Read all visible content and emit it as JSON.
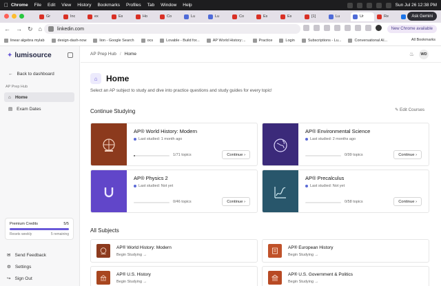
{
  "os_menubar": {
    "app": "Chrome",
    "items": [
      "File",
      "Edit",
      "View",
      "History",
      "Bookmarks",
      "Profiles",
      "Tab",
      "Window",
      "Help"
    ],
    "clock": "Sun Jul 26  12:38 PM"
  },
  "tabs": [
    {
      "label": "Gr",
      "color": "#d93025"
    },
    {
      "label": "Inc",
      "color": "#d93025"
    },
    {
      "label": "ex",
      "color": "#d93025"
    },
    {
      "label": "Es",
      "color": "#d93025"
    },
    {
      "label": "Ho",
      "color": "#d93025"
    },
    {
      "label": "Co",
      "color": "#d93025"
    },
    {
      "label": "Lu",
      "color": "#4f6bd8"
    },
    {
      "label": "Lu",
      "color": "#4f6bd8"
    },
    {
      "label": "Co",
      "color": "#d93025"
    },
    {
      "label": "Es",
      "color": "#d93025"
    },
    {
      "label": "Es",
      "color": "#d93025"
    },
    {
      "label": "[1]",
      "color": "#d93025"
    },
    {
      "label": "Lu",
      "color": "#4f6bd8"
    },
    {
      "label": "Ur",
      "color": "#4f6bd8"
    },
    {
      "label": "Re",
      "color": "#d93025"
    },
    {
      "label": "Im",
      "color": "#1a73e8"
    }
  ],
  "ask_gemini": "Ask Gemini",
  "address_bar": {
    "url": "linkedin.com"
  },
  "new_chrome": "New Chrome available",
  "bookmarks": [
    "linear algebra mylab",
    "design-dash-now",
    "lion - Google Search",
    "ocs",
    "Lovable - Build for...",
    "AP World History:...",
    "Practice",
    "Login",
    "Subscriptions - Lu...",
    "Conversational AI..."
  ],
  "all_bookmarks": "All Bookmarks",
  "sidebar": {
    "logo": "lumisource",
    "back": "Back to dashboard",
    "section": "AP Prep Hub",
    "items": [
      {
        "label": "Home",
        "active": true
      },
      {
        "label": "Exam Dates",
        "active": false
      }
    ],
    "credits": {
      "label": "Premium Credits",
      "count": "5/5",
      "resets": "Resets weekly",
      "remaining": "5 remaining",
      "fraction": 1.0
    },
    "bottom": [
      "Send Feedback",
      "Settings",
      "Sign Out"
    ]
  },
  "breadcrumb": [
    "AP Prep Hub",
    "Home"
  ],
  "avatar": "WD",
  "page": {
    "title": "Home",
    "subtitle": "Select an AP subject to study and dive into practice questions and study guides for every topic!"
  },
  "continue_studying": {
    "title": "Continue Studying",
    "edit": "Edit Courses",
    "cards": [
      {
        "title": "AP® World History: Modern",
        "last": "Last studied: 1 month ago",
        "topics": "1/71 topics",
        "progress": 0.014,
        "color": "#8c3a1d",
        "button": "Continue"
      },
      {
        "title": "AP® Environmental Science",
        "last": "Last studied: 2 months ago",
        "topics": "0/99 topics",
        "progress": 0,
        "color": "#3b2a7a",
        "button": "Continue"
      },
      {
        "title": "AP® Physics 2",
        "last": "Last studied: Not yet",
        "topics": "0/46 topics",
        "progress": 0,
        "color": "#6146c9",
        "button": "Continue"
      },
      {
        "title": "AP® Precalculus",
        "last": "Last studied: Not yet",
        "topics": "0/58 topics",
        "progress": 0,
        "color": "#28566b",
        "button": "Continue"
      }
    ]
  },
  "all_subjects": {
    "title": "All Subjects",
    "items": [
      {
        "title": "AP® World History: Modern",
        "begin": "Begin Studying →",
        "color": "#8c3a1d"
      },
      {
        "title": "AP® European History",
        "begin": "Begin Studying →",
        "color": "#c0522a"
      },
      {
        "title": "AP® U.S. History",
        "begin": "Begin Studying →",
        "color": "#a8461f"
      },
      {
        "title": "AP® U.S. Government & Politics",
        "begin": "Begin Studying →",
        "color": "#b84a24"
      }
    ]
  }
}
